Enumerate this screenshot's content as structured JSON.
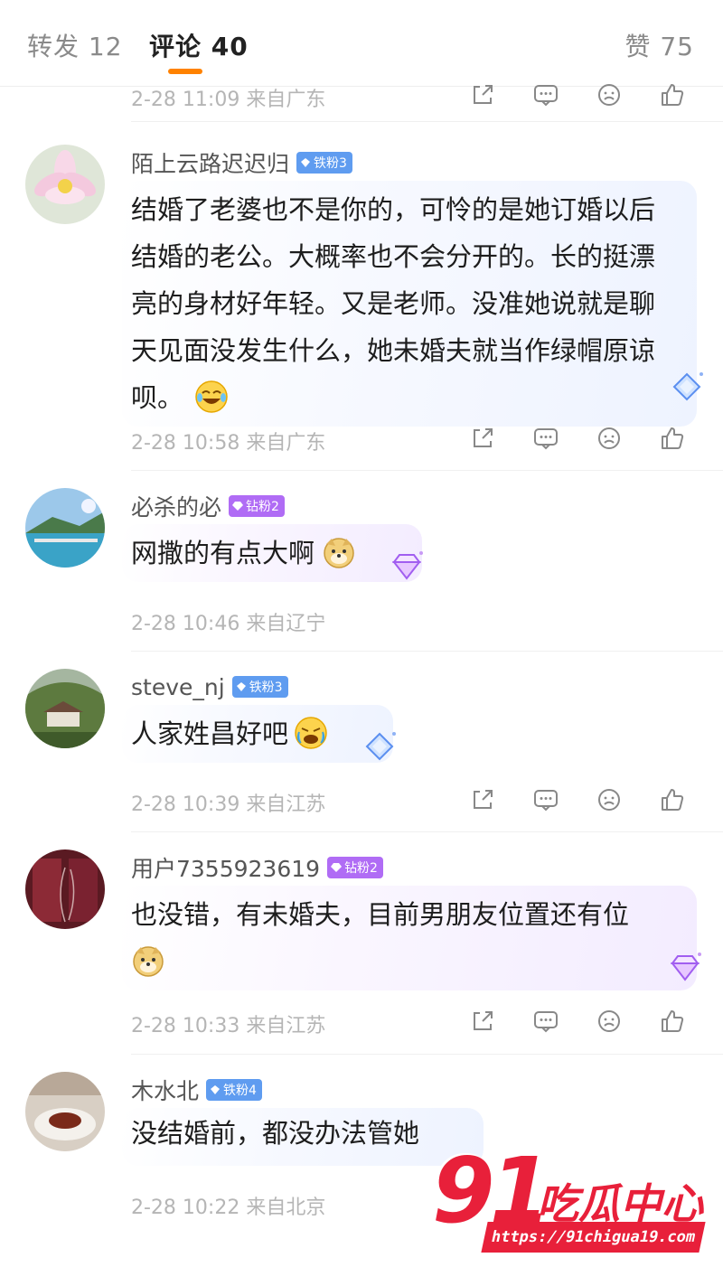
{
  "tabs": {
    "repost": "转发 12",
    "comment": "评论 40",
    "like": "赞 75"
  },
  "top_partial": {
    "meta": "2-28 11:09  来自广东"
  },
  "comments": [
    {
      "user": "陌上云路迟迟归",
      "badge": "铁粉3",
      "lines": [
        "结婚了老婆也不是你的，可怜的是她订婚以后",
        "结婚的老公。大概率也不会分开的。长的挺漂",
        "亮的身材好年轻。又是老师。没准她说就是聊",
        "天见面没发生什么，她未婚夫就当作绿帽原谅",
        "呗。"
      ],
      "emoji": "laugh-tears-emoji",
      "meta": "2-28 10:58  来自广东"
    },
    {
      "user": "必杀的必",
      "badge": "钻粉2",
      "text": "网撒的有点大啊",
      "emoji": "doge-emoji",
      "meta": "2-28 10:46  来自辽宁"
    },
    {
      "user": "steve_nj",
      "badge": "铁粉3",
      "text": "人家姓昌好吧",
      "emoji": "crying-laugh-emoji",
      "meta": "2-28 10:39  来自江苏"
    },
    {
      "user": "用户7355923619",
      "badge": "钻粉2",
      "text": "也没错，有未婚夫，目前男朋友位置还有位",
      "emoji": "doge-emoji",
      "meta": "2-28 10:33  来自江苏"
    },
    {
      "user": "木水北",
      "badge": "铁粉4",
      "text": "没结婚前，都没办法管她",
      "meta": "2-28 10:22  来自北京"
    }
  ],
  "watermark": {
    "number": "91",
    "name": "吃瓜中心",
    "url": "https://91chigua19.com"
  },
  "colors": {
    "accent": "#ff8200",
    "iron_badge": "#5f9cf0",
    "diamond_badge": "#b06cf5",
    "watermark": "#e8203a"
  }
}
